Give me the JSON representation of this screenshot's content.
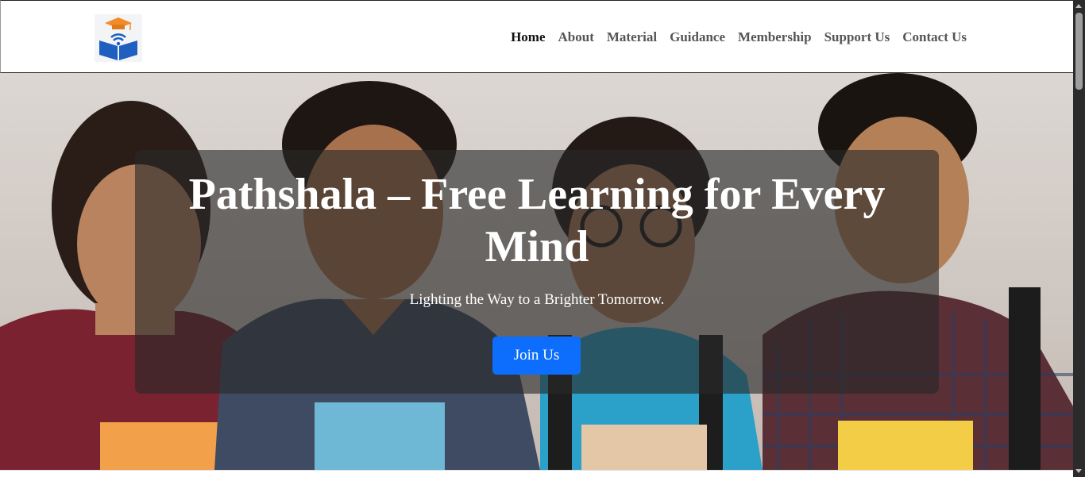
{
  "header": {
    "logo_icon": "book-graduation-cap-wifi-icon",
    "nav": [
      {
        "label": "Home",
        "active": true
      },
      {
        "label": "About",
        "active": false
      },
      {
        "label": "Material",
        "active": false
      },
      {
        "label": "Guidance",
        "active": false
      },
      {
        "label": "Membership",
        "active": false
      },
      {
        "label": "Support Us",
        "active": false
      },
      {
        "label": "Contact Us",
        "active": false
      }
    ]
  },
  "hero": {
    "title": "Pathshala – Free Learning for Every Mind",
    "subtitle": "Lighting the Way to a Brighter Tomorrow.",
    "cta_label": "Join Us"
  },
  "colors": {
    "accent": "#0d6efd",
    "nav_text": "#555555",
    "nav_active": "#111111",
    "overlay": "rgba(40,40,40,0.62)",
    "logo_orange": "#f28c28",
    "logo_blue": "#1f5fbf"
  }
}
